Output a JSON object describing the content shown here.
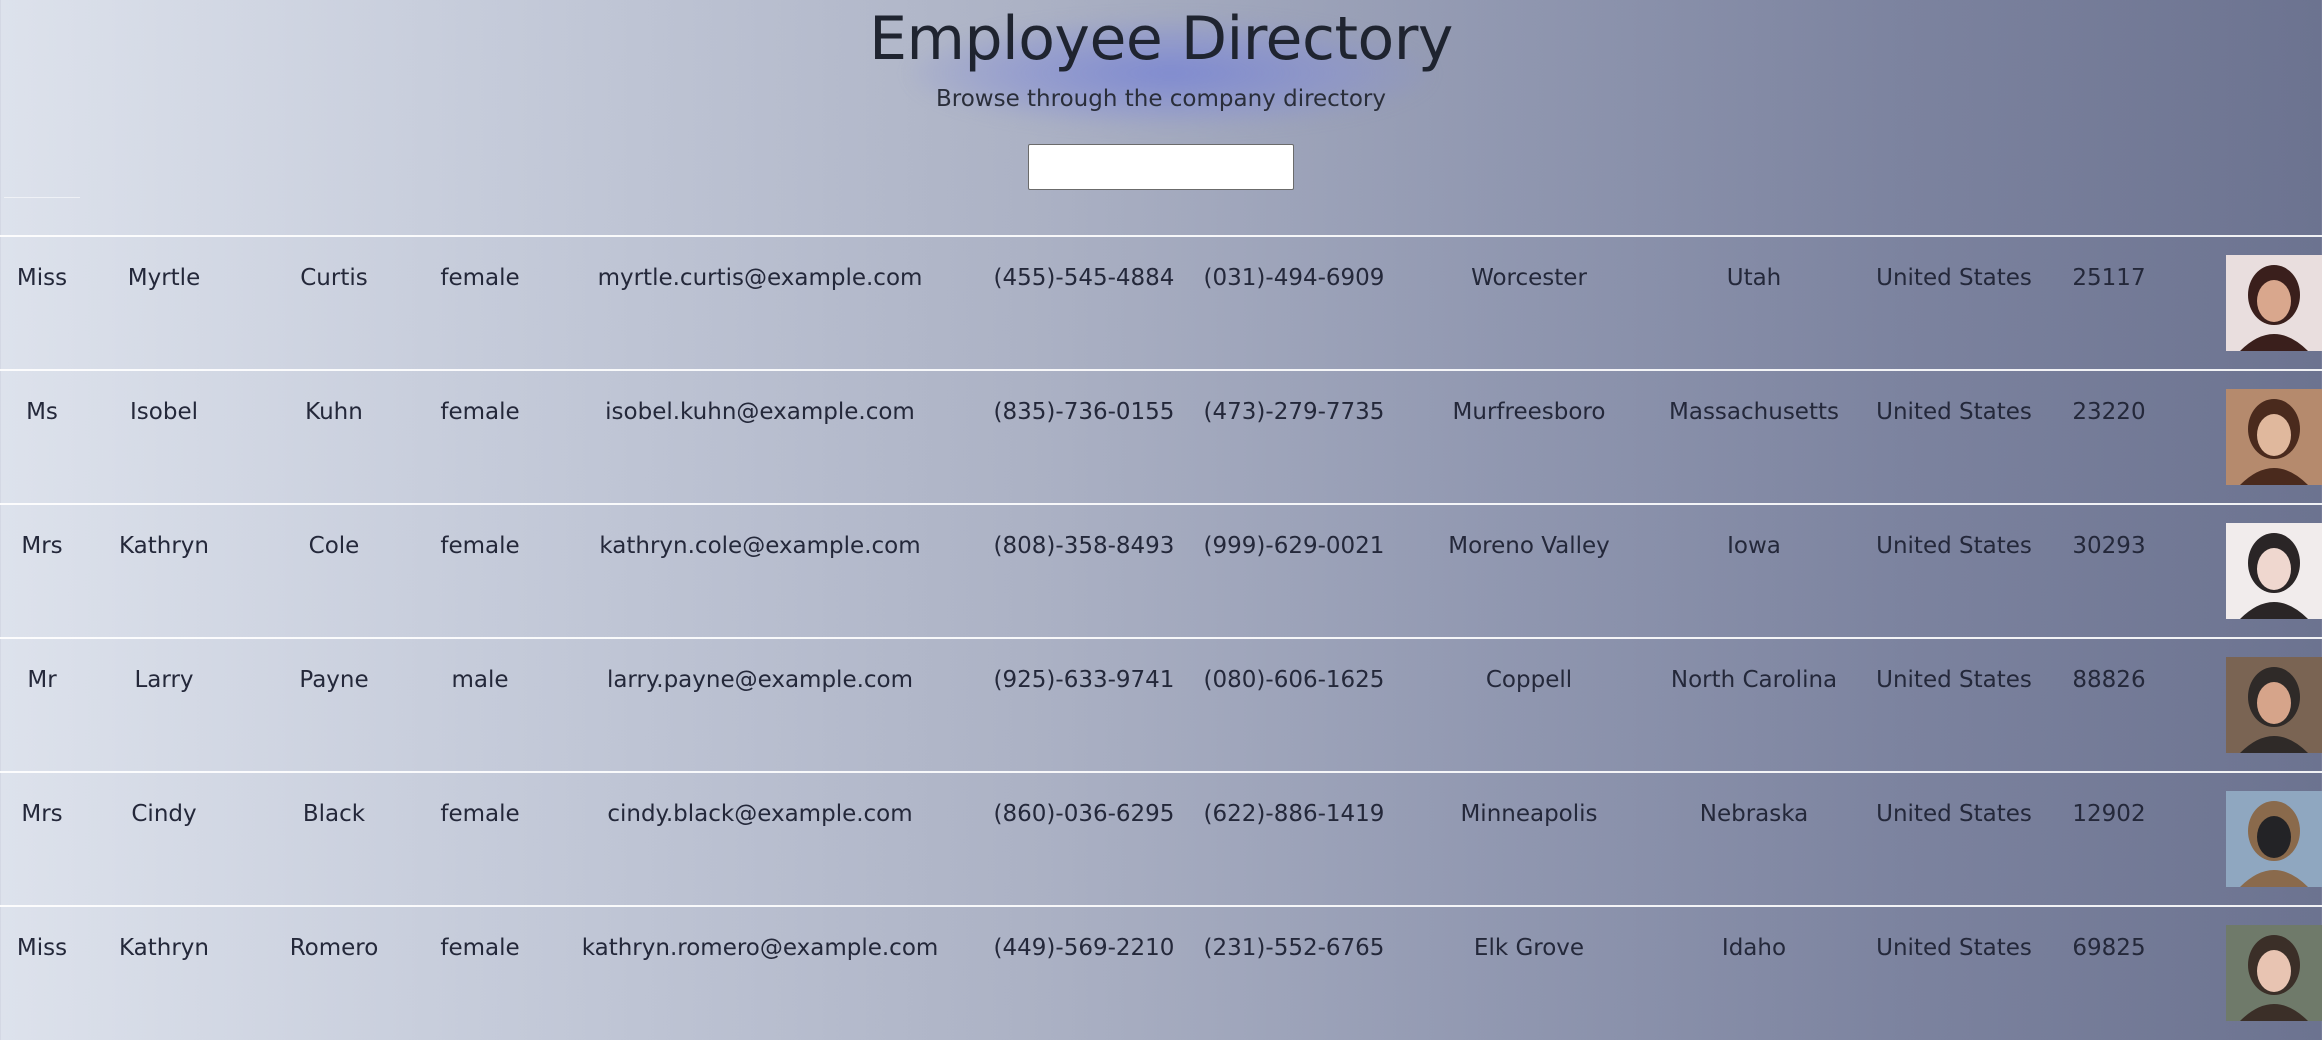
{
  "header": {
    "title": "Employee Directory",
    "subtitle": "Browse through the company directory",
    "search": {
      "value": "",
      "placeholder": ""
    }
  },
  "employees": [
    {
      "title": "Miss",
      "first": "Myrtle",
      "last": "Curtis",
      "gender": "female",
      "email": "myrtle.curtis@example.com",
      "phone": "(455)-545-4884",
      "cell": "(031)-494-6909",
      "city": "Worcester",
      "state": "Utah",
      "country": "United States",
      "postcode": "25117",
      "avatar_icon": "woman-photo",
      "avatar_colors": [
        "#e9dede",
        "#3a1f1c",
        "#d9a78d"
      ]
    },
    {
      "title": "Ms",
      "first": "Isobel",
      "last": "Kuhn",
      "gender": "female",
      "email": "isobel.kuhn@example.com",
      "phone": "(835)-736-0155",
      "cell": "(473)-279-7735",
      "city": "Murfreesboro",
      "state": "Massachusetts",
      "country": "United States",
      "postcode": "23220",
      "avatar_icon": "woman-photo",
      "avatar_colors": [
        "#b58a6d",
        "#4a2a1d",
        "#e0b89d"
      ]
    },
    {
      "title": "Mrs",
      "first": "Kathryn",
      "last": "Cole",
      "gender": "female",
      "email": "kathryn.cole@example.com",
      "phone": "(808)-358-8493",
      "cell": "(999)-629-0021",
      "city": "Moreno Valley",
      "state": "Iowa",
      "country": "United States",
      "postcode": "30293",
      "avatar_icon": "woman-photo",
      "avatar_colors": [
        "#f1ecec",
        "#2a2526",
        "#efd7cf"
      ]
    },
    {
      "title": "Mr",
      "first": "Larry",
      "last": "Payne",
      "gender": "male",
      "email": "larry.payne@example.com",
      "phone": "(925)-633-9741",
      "cell": "(080)-606-1625",
      "city": "Coppell",
      "state": "North Carolina",
      "country": "United States",
      "postcode": "88826",
      "avatar_icon": "man-photo",
      "avatar_colors": [
        "#7a6453",
        "#2f2a28",
        "#d6a48a"
      ]
    },
    {
      "title": "Mrs",
      "first": "Cindy",
      "last": "Black",
      "gender": "female",
      "email": "cindy.black@example.com",
      "phone": "(860)-036-6295",
      "cell": "(622)-886-1419",
      "city": "Minneapolis",
      "state": "Nebraska",
      "country": "United States",
      "postcode": "12902",
      "avatar_icon": "woman-photo",
      "avatar_colors": [
        "#8fa7c0",
        "#8a6a4c",
        "#232326"
      ]
    },
    {
      "title": "Miss",
      "first": "Kathryn",
      "last": "Romero",
      "gender": "female",
      "email": "kathryn.romero@example.com",
      "phone": "(449)-569-2210",
      "cell": "(231)-552-6765",
      "city": "Elk Grove",
      "state": "Idaho",
      "country": "United States",
      "postcode": "69825",
      "avatar_icon": "woman-photo",
      "avatar_colors": [
        "#6f7a6a",
        "#3b2f28",
        "#e8c4b2"
      ]
    }
  ]
}
